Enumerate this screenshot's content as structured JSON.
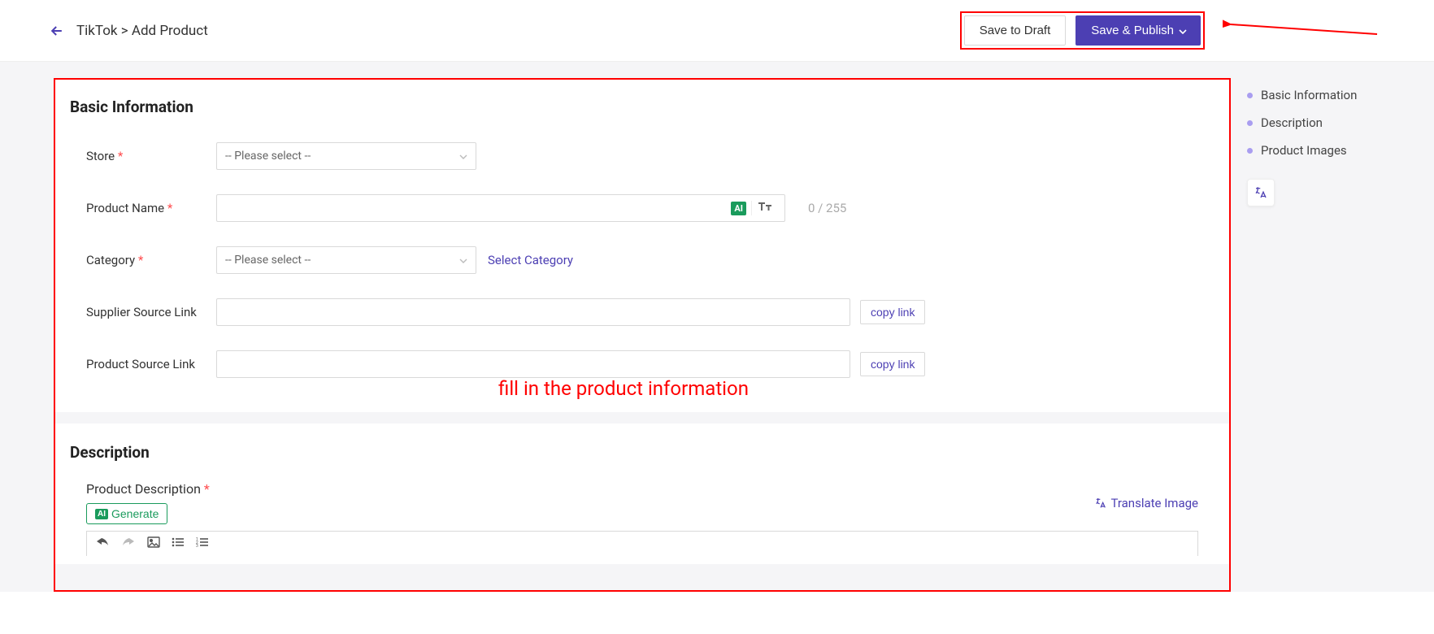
{
  "header": {
    "breadcrumb": "TikTok > Add Product",
    "save_draft": "Save to Draft",
    "save_publish": "Save & Publish"
  },
  "sections": {
    "basic_info_title": "Basic Information",
    "description_title": "Description"
  },
  "fields": {
    "store_label": "Store",
    "store_placeholder": "-- Please select --",
    "product_name_label": "Product Name",
    "char_count": "0 / 255",
    "category_label": "Category",
    "category_placeholder": "-- Please select --",
    "select_category_link": "Select Category",
    "supplier_source_label": "Supplier Source Link",
    "product_source_label": "Product Source Link",
    "copy_link": "copy link",
    "product_description_label": "Product Description",
    "generate": "Generate",
    "translate_image": "Translate Image"
  },
  "nav": {
    "item1": "Basic Information",
    "item2": "Description",
    "item3": "Product Images"
  },
  "annotations": {
    "fill_in": "fill in the product information"
  }
}
